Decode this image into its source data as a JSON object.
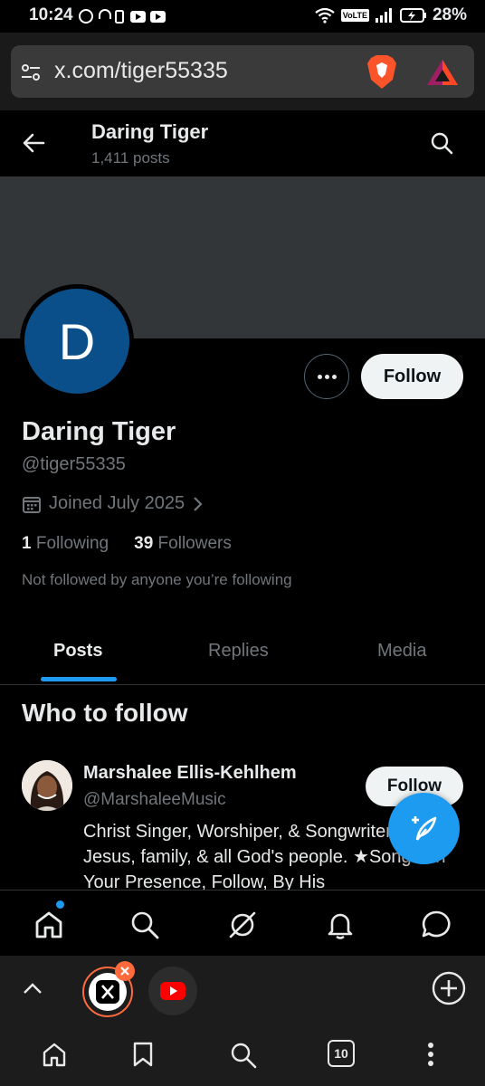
{
  "status_bar": {
    "time": "10:24",
    "battery": "28%",
    "volte": "VoLTE"
  },
  "browser": {
    "url": "x.com/tiger55335",
    "tab_count": "10"
  },
  "header": {
    "title": "Daring Tiger",
    "posts": "1,411 posts"
  },
  "profile": {
    "avatar_letter": "D",
    "name": "Daring Tiger",
    "handle": "@tiger55335",
    "joined": "Joined July 2025",
    "following_count": "1",
    "following_label": "Following",
    "followers_count": "39",
    "followers_label": "Followers",
    "not_followed": "Not followed by anyone you’re following",
    "follow_label": "Follow"
  },
  "tabs": [
    "Posts",
    "Replies",
    "Media"
  ],
  "who_to_follow": {
    "title": "Who to follow",
    "suggestion": {
      "name": "Marshalee Ellis-Kehlhem",
      "handle": "@MarshaleeMusic",
      "bio": "Christ Singer, Worshiper, & Songwriter. Loves Jesus, family, & all God's people. ★Songs: In Your Presence, Follow, By His",
      "follow_label": "Follow"
    }
  },
  "colors": {
    "accent": "#1d9bf0",
    "avatar_bg": "#0b4f8a",
    "banner": "#333639"
  },
  "icons": {
    "x_nav": [
      "home-icon",
      "search-icon",
      "grok-icon",
      "notifications-icon",
      "messages-icon"
    ],
    "browser_nav": [
      "home-icon",
      "bookmark-icon",
      "search-icon",
      "tabs-icon",
      "menu-icon"
    ]
  }
}
